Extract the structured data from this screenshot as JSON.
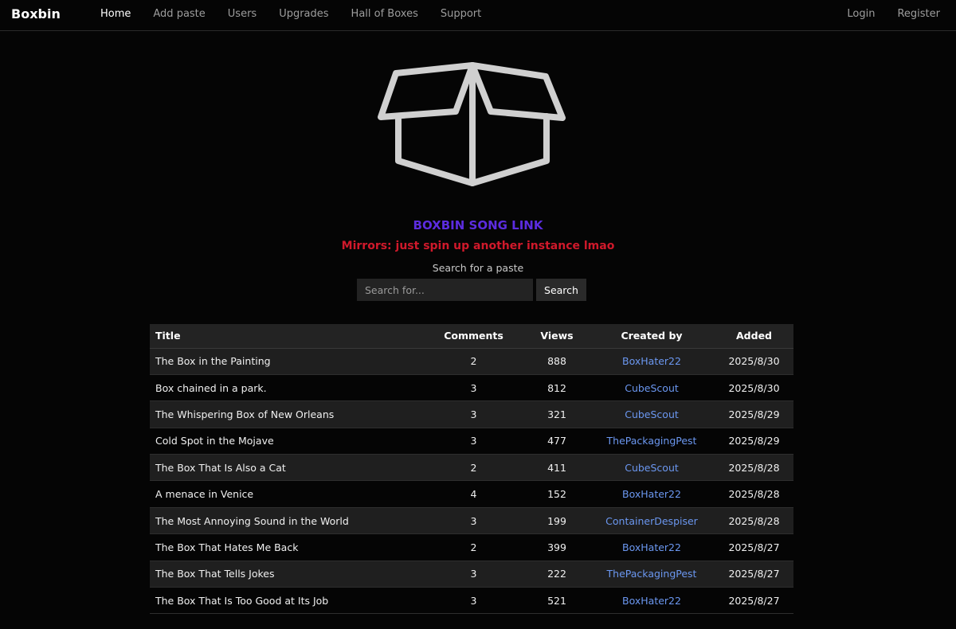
{
  "navbar": {
    "brand": "Boxbin",
    "links": [
      {
        "label": "Home",
        "active": true
      },
      {
        "label": "Add paste"
      },
      {
        "label": "Users"
      },
      {
        "label": "Upgrades"
      },
      {
        "label": "Hall of Boxes"
      },
      {
        "label": "Support"
      }
    ],
    "login_label": "Login",
    "register_label": "Register"
  },
  "logo": {
    "icon": "open-box-icon",
    "stroke_color": "#d0d0d0"
  },
  "hero": {
    "song_link": "BOXBIN SONG LINK",
    "song_link_color": "#5c2ce0",
    "mirrors_text": "Mirrors: just spin up another instance lmao",
    "mirrors_color": "#d0192b"
  },
  "search": {
    "label": "Search for a paste",
    "placeholder": "Search for...",
    "button_label": "Search"
  },
  "table": {
    "headers": {
      "title": "Title",
      "comments": "Comments",
      "views": "Views",
      "created_by": "Created by",
      "added": "Added"
    },
    "rows": [
      {
        "title": "The Box in the Painting",
        "comments": "2",
        "views": "888",
        "created_by": "BoxHater22",
        "added": "2025/8/30"
      },
      {
        "title": "Box chained in a park.",
        "comments": "3",
        "views": "812",
        "created_by": "CubeScout",
        "added": "2025/8/30"
      },
      {
        "title": "The Whispering Box of New Orleans",
        "comments": "3",
        "views": "321",
        "created_by": "CubeScout",
        "added": "2025/8/29"
      },
      {
        "title": "Cold Spot in the Mojave",
        "comments": "3",
        "views": "477",
        "created_by": "ThePackagingPest",
        "added": "2025/8/29"
      },
      {
        "title": "The Box That Is Also a Cat",
        "comments": "2",
        "views": "411",
        "created_by": "CubeScout",
        "added": "2025/8/28"
      },
      {
        "title": "A menace in Venice",
        "comments": "4",
        "views": "152",
        "created_by": "BoxHater22",
        "added": "2025/8/28"
      },
      {
        "title": "The Most Annoying Sound in the World",
        "comments": "3",
        "views": "199",
        "created_by": "ContainerDespiser",
        "added": "2025/8/28"
      },
      {
        "title": "The Box That Hates Me Back",
        "comments": "2",
        "views": "399",
        "created_by": "BoxHater22",
        "added": "2025/8/27"
      },
      {
        "title": "The Box That Tells Jokes",
        "comments": "3",
        "views": "222",
        "created_by": "ThePackagingPest",
        "added": "2025/8/27"
      },
      {
        "title": "The Box That Is Too Good at Its Job",
        "comments": "3",
        "views": "521",
        "created_by": "BoxHater22",
        "added": "2025/8/27"
      }
    ],
    "link_color": "#6b97f0"
  }
}
